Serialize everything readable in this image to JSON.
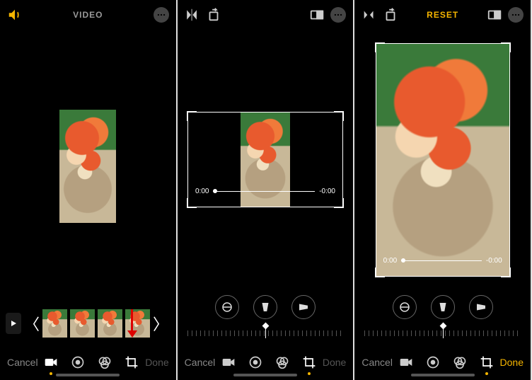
{
  "panels": [
    {
      "id": "video-edit",
      "topbar": {
        "title": "VIDEO",
        "title_color": "#999"
      },
      "timeline": {
        "frames": 4
      },
      "bottombar": {
        "cancel": "Cancel",
        "done": "Done",
        "done_active": false,
        "active_tool": "video"
      }
    },
    {
      "id": "crop-landscape",
      "time": {
        "start": "0:00",
        "end": "-0:00"
      },
      "bottombar": {
        "cancel": "Cancel",
        "done": "Done",
        "done_active": false,
        "active_tool": "crop"
      }
    },
    {
      "id": "crop-portrait",
      "topbar": {
        "title": "RESET",
        "title_color": "#f5b500"
      },
      "time": {
        "start": "0:00",
        "end": "-0:00"
      },
      "bottombar": {
        "cancel": "Cancel",
        "done": "Done",
        "done_active": true,
        "active_tool": "crop"
      }
    }
  ],
  "icons": {
    "volume": "volume-icon",
    "more": "more-icon",
    "flip_h": "flip-horizontal-icon",
    "rotate": "rotate-icon",
    "aspect": "aspect-ratio-icon",
    "straighten": "straighten-icon",
    "skew_v": "vertical-skew-icon",
    "skew_h": "horizontal-skew-icon",
    "play": "play-icon",
    "camera": "video-tool-icon",
    "adjust": "adjust-tool-icon",
    "filters": "filters-tool-icon",
    "crop": "crop-tool-icon"
  }
}
